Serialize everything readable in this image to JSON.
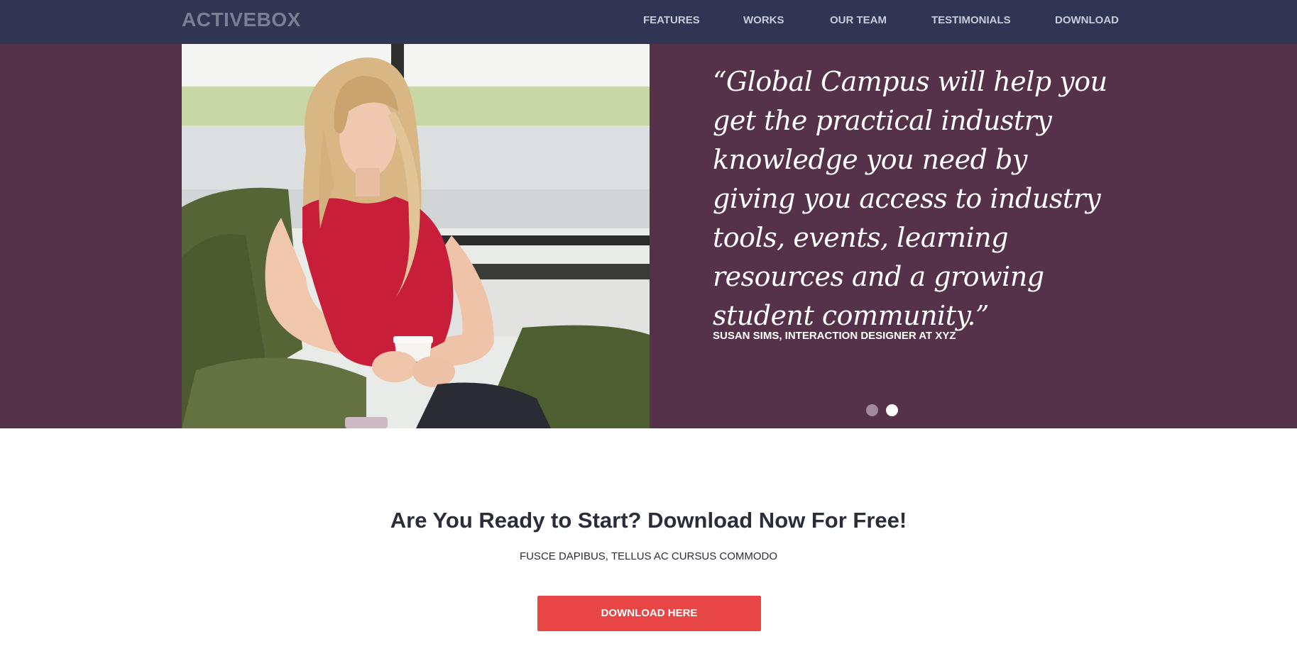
{
  "header": {
    "brand": "ACTIVEBOX",
    "nav": [
      {
        "label": "FEATURES"
      },
      {
        "label": "WORKS"
      },
      {
        "label": "OUR TEAM"
      },
      {
        "label": "TESTIMONIALS"
      },
      {
        "label": "DOWNLOAD"
      }
    ]
  },
  "testimonial": {
    "quote": "“Global Campus will help you get the practical industry knowledge you need by giving you access to industry tools, events, learning resources and a growing student community.”",
    "author": "SUSAN SIMS, INTERACTION DESIGNER AT XYZ",
    "slides_total": 2,
    "active_slide": 2
  },
  "cta": {
    "title": "Are You Ready to Start? Download Now For Free!",
    "subtitle": "FUSCE DAPIBUS, TELLUS AC CURSUS COMMODO",
    "button_label": "DOWNLOAD HERE"
  },
  "colors": {
    "navbar_bg": "#2f3552",
    "testimonial_bg": "#55324a",
    "button_red": "#e84545",
    "text_dark": "#2a2d3a"
  }
}
